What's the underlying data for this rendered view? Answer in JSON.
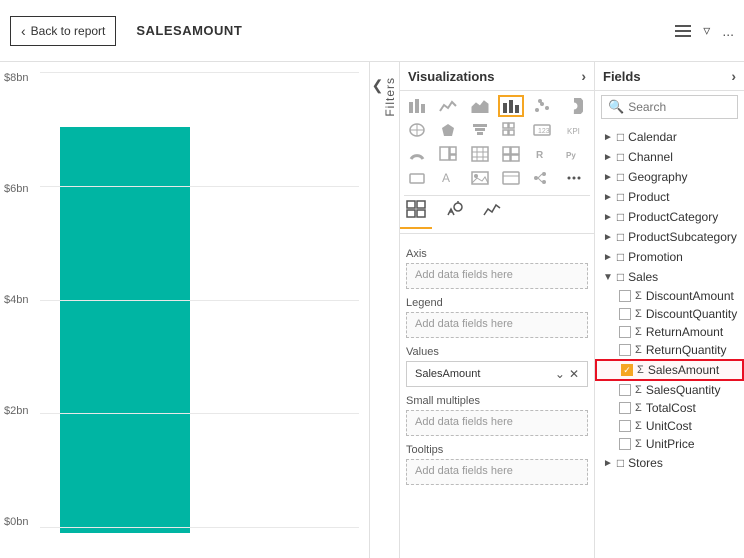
{
  "topBar": {
    "backLabel": "Back to report",
    "fieldTitle": "SALESAMOUNT",
    "filterIcon": "⊤",
    "moreIcon": "..."
  },
  "chart": {
    "yLabels": [
      "$8bn",
      "$6bn",
      "$4bn",
      "$2bn",
      "$0bn"
    ],
    "barHeightPercent": 88
  },
  "filters": {
    "label": "Filters",
    "expandIcon": "❮"
  },
  "visualizations": {
    "header": "Visualizations",
    "headerArrow": "›",
    "icons": [
      {
        "name": "stacked-bar-icon",
        "symbol": "▤"
      },
      {
        "name": "line-chart-icon",
        "symbol": "📈"
      },
      {
        "name": "area-chart-icon",
        "symbol": "▲"
      },
      {
        "name": "bar-chart-active-icon",
        "symbol": "▌▌"
      },
      {
        "name": "scatter-icon",
        "symbol": "⋯"
      },
      {
        "name": "pie-icon",
        "symbol": "◕"
      },
      {
        "name": "map-icon",
        "symbol": "🗺"
      },
      {
        "name": "funnel-icon",
        "symbol": "⬡"
      },
      {
        "name": "matrix-icon",
        "symbol": "⊞"
      },
      {
        "name": "card-icon",
        "symbol": "▭"
      },
      {
        "name": "kpi-icon",
        "symbol": "📊"
      },
      {
        "name": "gauge-icon",
        "symbol": "◔"
      },
      {
        "name": "treemap-icon",
        "symbol": "▪"
      },
      {
        "name": "waterfall-icon",
        "symbol": "↕"
      },
      {
        "name": "ribbon-icon",
        "symbol": "〰"
      },
      {
        "name": "table-icon",
        "symbol": "⊟"
      },
      {
        "name": "matrix2-icon",
        "symbol": "⊞"
      },
      {
        "name": "r-script-icon",
        "symbol": "R"
      },
      {
        "name": "python-icon",
        "symbol": "Py"
      },
      {
        "name": "custom-icon",
        "symbol": "fx"
      },
      {
        "name": "shape-icon",
        "symbol": "▭"
      },
      {
        "name": "text-icon",
        "symbol": "A"
      },
      {
        "name": "image-icon",
        "symbol": "🖼"
      },
      {
        "name": "web-icon",
        "symbol": "≡"
      },
      {
        "name": "decomp-icon",
        "symbol": "⬢"
      },
      {
        "name": "more-icon",
        "symbol": "..."
      }
    ],
    "buildTabs": [
      {
        "id": "fields",
        "icon": "⊞",
        "label": ""
      },
      {
        "id": "format",
        "icon": "🖌",
        "label": ""
      },
      {
        "id": "analytics",
        "icon": "📊",
        "label": ""
      }
    ],
    "sections": [
      {
        "id": "axis",
        "label": "Axis",
        "dropzone": "Add data fields here",
        "hasValue": false,
        "value": ""
      },
      {
        "id": "legend",
        "label": "Legend",
        "dropzone": "Add data fields here",
        "hasValue": false,
        "value": ""
      },
      {
        "id": "values",
        "label": "Values",
        "dropzone": "Add data fields here",
        "hasValue": true,
        "value": "SalesAmount"
      },
      {
        "id": "small-multiples",
        "label": "Small multiples",
        "dropzone": "Add data fields here",
        "hasValue": false,
        "value": ""
      },
      {
        "id": "tooltips",
        "label": "Tooltips",
        "dropzone": "Add data fields here",
        "hasValue": false,
        "value": ""
      }
    ]
  },
  "fields": {
    "header": "Fields",
    "headerArrow": "›",
    "search": {
      "placeholder": "Search",
      "value": ""
    },
    "groups": [
      {
        "name": "Calendar",
        "expanded": false,
        "icon": "⊞",
        "items": []
      },
      {
        "name": "Channel",
        "expanded": false,
        "icon": "⊞",
        "items": []
      },
      {
        "name": "Geography",
        "expanded": false,
        "icon": "⊞",
        "items": []
      },
      {
        "name": "Product",
        "expanded": false,
        "icon": "⊞",
        "items": []
      },
      {
        "name": "ProductCategory",
        "expanded": false,
        "icon": "⊞",
        "items": []
      },
      {
        "name": "ProductSubcategory",
        "expanded": false,
        "icon": "⊞",
        "items": []
      },
      {
        "name": "Promotion",
        "expanded": false,
        "icon": "⊞",
        "items": []
      },
      {
        "name": "Sales",
        "expanded": true,
        "icon": "⊞",
        "items": [
          {
            "name": "DiscountAmount",
            "checked": false,
            "selected": false
          },
          {
            "name": "DiscountQuantity",
            "checked": false,
            "selected": false
          },
          {
            "name": "ReturnAmount",
            "checked": false,
            "selected": false
          },
          {
            "name": "ReturnQuantity",
            "checked": false,
            "selected": false
          },
          {
            "name": "SalesAmount",
            "checked": true,
            "selected": true
          },
          {
            "name": "SalesQuantity",
            "checked": false,
            "selected": false
          },
          {
            "name": "TotalCost",
            "checked": false,
            "selected": false
          },
          {
            "name": "UnitCost",
            "checked": false,
            "selected": false
          },
          {
            "name": "UnitPrice",
            "checked": false,
            "selected": false
          }
        ]
      },
      {
        "name": "Stores",
        "expanded": false,
        "icon": "⊞",
        "items": []
      }
    ]
  }
}
